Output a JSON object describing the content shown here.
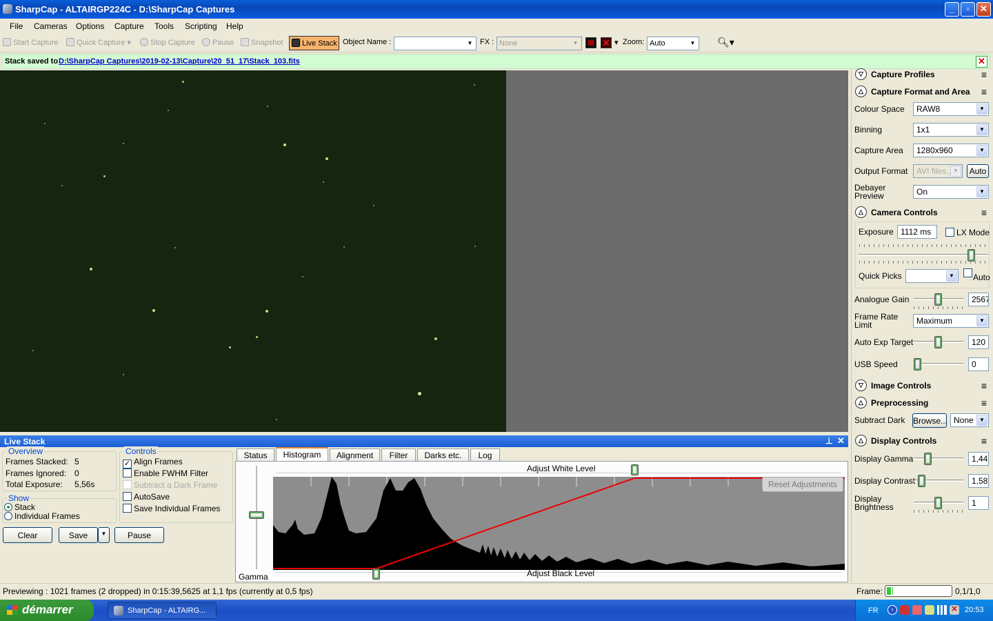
{
  "window": {
    "title": "SharpCap - ALTAIRGP224C - D:\\SharpCap Captures",
    "minimize_icon": "minimize-icon",
    "maximize_icon": "restore-icon",
    "close_icon": "close-icon"
  },
  "menu": [
    "File",
    "Cameras",
    "Options",
    "Capture",
    "Tools",
    "Scripting",
    "Help"
  ],
  "toolbar": {
    "start_capture": "Start Capture",
    "quick_capture": "Quick Capture",
    "stop_capture": "Stop Capture",
    "pause": "Pause",
    "snapshot": "Snapshot",
    "live_stack": "Live Stack",
    "object_name_label": "Object Name :",
    "object_name_value": "",
    "fx_label": "FX :",
    "fx_value": "None",
    "zoom_label": "Zoom:",
    "zoom_value": "Auto"
  },
  "notification": {
    "label": "Stack saved to",
    "path": "D:\\SharpCap Captures\\2019-02-13\\Capture\\20_51_17\\Stack_103.fits"
  },
  "right_panel": {
    "capture_profiles": "Capture Profiles",
    "capture_format": {
      "title": "Capture Format and Area",
      "colour_space_label": "Colour Space",
      "colour_space": "RAW8",
      "binning_label": "Binning",
      "binning": "1x1",
      "capture_area_label": "Capture Area",
      "capture_area": "1280x960",
      "output_format_label": "Output Format",
      "output_format": "AVI files...",
      "auto_button": "Auto",
      "debayer_label_1": "Debayer",
      "debayer_label_2": "Preview",
      "debayer": "On"
    },
    "camera_controls": {
      "title": "Camera Controls",
      "exposure_label": "Exposure",
      "exposure": "1112 ms",
      "lx_mode": "LX Mode",
      "quick_picks_label": "Quick Picks",
      "quick_picks": "",
      "auto_label": "Auto",
      "gain_label": "Analogue Gain",
      "gain": "2567",
      "frame_rate_label_1": "Frame Rate",
      "frame_rate_label_2": "Limit",
      "frame_rate": "Maximum",
      "auto_exp_label": "Auto Exp Target",
      "auto_exp": "120",
      "usb_label": "USB Speed",
      "usb": "0"
    },
    "image_controls": "Image Controls",
    "preprocessing": {
      "title": "Preprocessing",
      "subtract_dark_label": "Subtract Dark",
      "browse_button": "Browse...",
      "dark_value": "None"
    },
    "display_controls": {
      "title": "Display Controls",
      "gamma_label": "Display Gamma",
      "gamma": "1,44",
      "contrast_label": "Display Contrast",
      "contrast": "1,58",
      "brightness_label_1": "Display",
      "brightness_label_2": "Brightness",
      "brightness": "1"
    }
  },
  "live_stack": {
    "title": "Live Stack",
    "overview": {
      "title": "Overview",
      "frames_stacked_label": "Frames Stacked:",
      "frames_stacked": "5",
      "frames_ignored_label": "Frames Ignored:",
      "frames_ignored": "0",
      "total_exposure_label": "Total Exposure:",
      "total_exposure": "5,56s"
    },
    "show": {
      "title": "Show",
      "stack": "Stack",
      "individual": "Individual Frames"
    },
    "controls": {
      "title": "Controls",
      "align_frames": "Align Frames",
      "fwhm": "Enable FWHM Filter",
      "subtract_dark": "Subtract a Dark Frame",
      "autosave": "AutoSave",
      "save_individual": "Save Individual Frames"
    },
    "buttons": {
      "clear": "Clear",
      "save": "Save",
      "pause": "Pause"
    },
    "tabs": [
      "Status",
      "Histogram",
      "Alignment",
      "Filter",
      "Darks etc.",
      "Log"
    ],
    "histogram": {
      "white_level": "Adjust White Level",
      "black_level": "Adjust Black Level",
      "reset": "Reset Adjustments",
      "gamma": "Gamma"
    }
  },
  "status": {
    "previewing": "Previewing : 1021 frames (2 dropped) in 0:15:39,5625 at 1,1 fps  (currently at 0,5 fps)",
    "frame_label": "Frame:",
    "frame_value": "0,1/1,0",
    "frame_progress": 0.1
  },
  "taskbar": {
    "start": "démarrer",
    "app": "SharpCap - ALTAIRG...",
    "lang": "FR",
    "time": "20:53"
  }
}
